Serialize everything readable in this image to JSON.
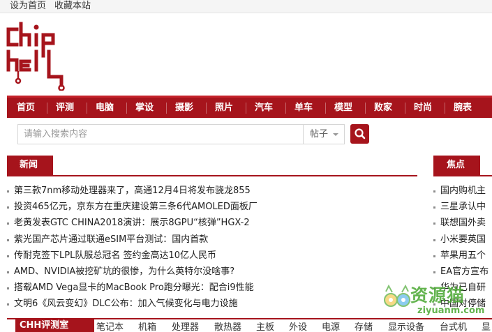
{
  "topbar": {
    "set_home": "设为首页",
    "bookmark": "收藏本站"
  },
  "logo": {
    "text": "chiphell",
    "color": "#a6141c"
  },
  "nav": {
    "items": [
      "首页",
      "评测",
      "电脑",
      "掌设",
      "摄影",
      "照片",
      "汽车",
      "单车",
      "模型",
      "败家",
      "时尚",
      "腕表"
    ]
  },
  "search": {
    "placeholder": "请输入搜索内容",
    "type_label": "帖子",
    "button_icon": "search-icon"
  },
  "news": {
    "title": "新闻",
    "items": [
      "第三款7nm移动处理器来了，高通12月4日将发布骁龙855",
      "投资465亿元，京东方在重庆建设第三条6代AMOLED面板厂",
      "老黄发表GTC CHINA2018演讲：展示8GPU“核弹”HGX-2",
      "紫光国产芯片通过联通eSIM平台测试：国内首款",
      "传耐克签下LPL队服总冠名 签约金高达10亿人民币",
      "AMD、NVIDIA被挖矿坑的很惨，为什么英特尔没啥事?",
      "搭载AMD Vega显卡的MacBook Pro跑分曝光：配合i9性能",
      "文明6《风云变幻》DLC公布：加入气候变化与电力设施"
    ]
  },
  "focus": {
    "title": "焦点",
    "items": [
      "国内购机主",
      "三星承认中",
      "联想国外卖",
      "小米要英国",
      "苹果用五个",
      "EA官方宣布",
      "华为已自研",
      "中国对停储"
    ]
  },
  "chh": {
    "title": "CHH评测室",
    "links": [
      "笔记本",
      "机箱",
      "处理器",
      "散热器",
      "主板",
      "外设",
      "电源",
      "存储",
      "显示设备",
      "台式机",
      "显"
    ]
  },
  "watermark": {
    "text": "资源猫",
    "url": "ziyuanm.com"
  },
  "colors": {
    "brand": "#a6141c",
    "nav_bg": "#a6141c",
    "watermark": "#4aa832"
  }
}
